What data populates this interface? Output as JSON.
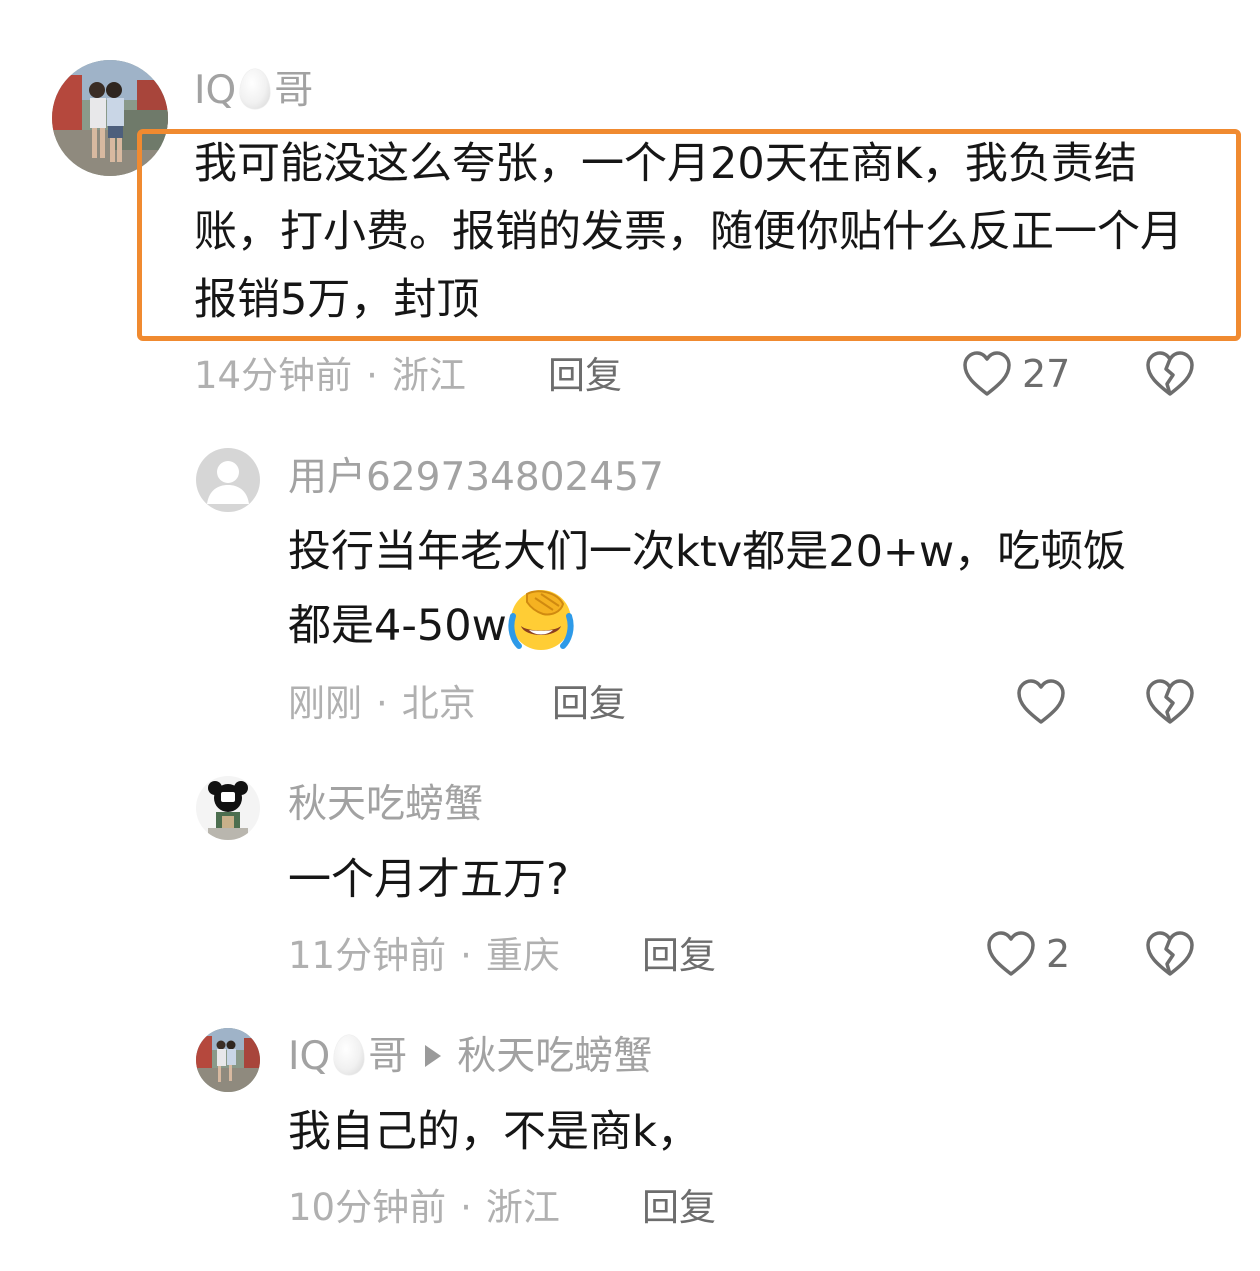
{
  "comments": [
    {
      "user_prefix": "IQ",
      "user_suffix": "哥",
      "text": "我可能没这么夸张，一个月20天在商K，我负责结账，打小费。报销的发票，随便你贴什么反正一个月报销5万，封顶",
      "time": "14分钟前",
      "location": "浙江",
      "reply_label": "回复",
      "likes": "27",
      "highlighted": true
    }
  ],
  "replies": [
    {
      "user": "用户629734802457",
      "text_line1": "投行当年老大们一次ktv都是20+w，吃顿饭",
      "text_line2": "都是4-50w",
      "emoji": "facepalm-laughing-emoji",
      "time": "刚刚",
      "location": "北京",
      "reply_label": "回复"
    },
    {
      "user": "秋天吃螃蟹",
      "text": "一个月才五万?",
      "time": "11分钟前",
      "location": "重庆",
      "reply_label": "回复",
      "likes": "2"
    },
    {
      "user_prefix": "IQ",
      "user_suffix": "哥",
      "reply_to": "秋天吃螃蟹",
      "text": "我自己的，不是商k，",
      "time": "10分钟前",
      "location": "浙江",
      "reply_label": "回复"
    }
  ],
  "meta_separator": "·",
  "colors": {
    "highlight_border": "#f08a30",
    "username": "#a2a2a2",
    "text": "#161616",
    "meta": "#b0b0b0"
  },
  "icons": [
    "heart-icon",
    "broken-heart-icon",
    "egg-emoji",
    "reply-arrow-icon",
    "facepalm-laughing-emoji"
  ]
}
